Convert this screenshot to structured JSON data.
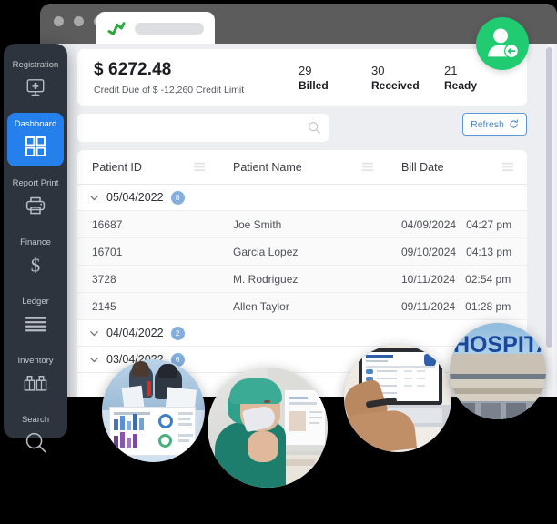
{
  "window": {
    "dots_count": 3,
    "tab_logo_icon": "green-zigzag-logo-icon",
    "tab_title_placeholder": ""
  },
  "sidebar": {
    "items": [
      {
        "label": "Registration",
        "icon": "monitor-plus-icon",
        "active": false
      },
      {
        "label": "Dashboard",
        "icon": "grid-2x2-icon",
        "active": true
      },
      {
        "label": "Report Print",
        "icon": "printer-icon",
        "active": false
      },
      {
        "label": "Finance",
        "icon": "dollar-sign-icon",
        "active": false
      },
      {
        "label": "Ledger",
        "icon": "lines-stack-icon",
        "active": false
      },
      {
        "label": "Inventory",
        "icon": "boxes-icon",
        "active": false
      },
      {
        "label": "Search",
        "icon": "magnifier-icon",
        "active": false
      }
    ]
  },
  "avatar": {
    "icon": "user-login-avatar-icon",
    "color": "#21cb72"
  },
  "summary": {
    "credit_amount": "$ 6272.48",
    "credit_subtitle": "Credit Due of $ -12,260 Credit Limit",
    "stats": [
      {
        "value": "29",
        "label": "Billed"
      },
      {
        "value": "30",
        "label": "Received"
      },
      {
        "value": "21",
        "label": "Ready"
      }
    ]
  },
  "toolbar": {
    "search_value": "",
    "search_placeholder": "",
    "search_icon": "magnifier-icon",
    "refresh_label": "Refresh",
    "refresh_icon": "refresh-circular-arrow-icon",
    "refresh_color": "#4a86c8"
  },
  "table": {
    "columns": [
      {
        "label": "Patient ID",
        "menu_icon": "hamburger-menu-icon"
      },
      {
        "label": "Patient Name",
        "menu_icon": "hamburger-menu-icon"
      },
      {
        "label": "Bill Date",
        "menu_icon": "hamburger-menu-icon"
      }
    ],
    "badge_color": "#83aede",
    "groups": [
      {
        "date": "05/04/2022",
        "count": "8",
        "expanded": true,
        "chevron_icon": "chevron-down-icon",
        "rows": [
          {
            "patient_id": "16687",
            "patient_name": "Joe Smith",
            "bill_date": "04/09/2024",
            "bill_time": "04:27 pm"
          },
          {
            "patient_id": "16701",
            "patient_name": "Garcia Lopez",
            "bill_date": "09/10/2024",
            "bill_time": "04:13 pm"
          },
          {
            "patient_id": "3728",
            "patient_name": "M. Rodriguez",
            "bill_date": "10/11/2024",
            "bill_time": "02:54 pm"
          },
          {
            "patient_id": "2145",
            "patient_name": "Allen Taylor",
            "bill_date": "09/11/2024",
            "bill_time": "01:28 pm"
          }
        ]
      },
      {
        "date": "04/04/2022",
        "count": "2",
        "expanded": false,
        "chevron_icon": "chevron-down-icon",
        "rows": []
      },
      {
        "date": "03/04/2022",
        "count": "6",
        "expanded": false,
        "chevron_icon": "chevron-down-icon",
        "rows": []
      }
    ]
  },
  "photos": [
    {
      "name": "lab-technicians-analytics-photo",
      "caption": ""
    },
    {
      "name": "nurse-at-computer-photo",
      "caption": ""
    },
    {
      "name": "insurance-plans-laptop-photo",
      "caption": ""
    },
    {
      "name": "hospital-building-sign-photo",
      "caption": ""
    }
  ]
}
